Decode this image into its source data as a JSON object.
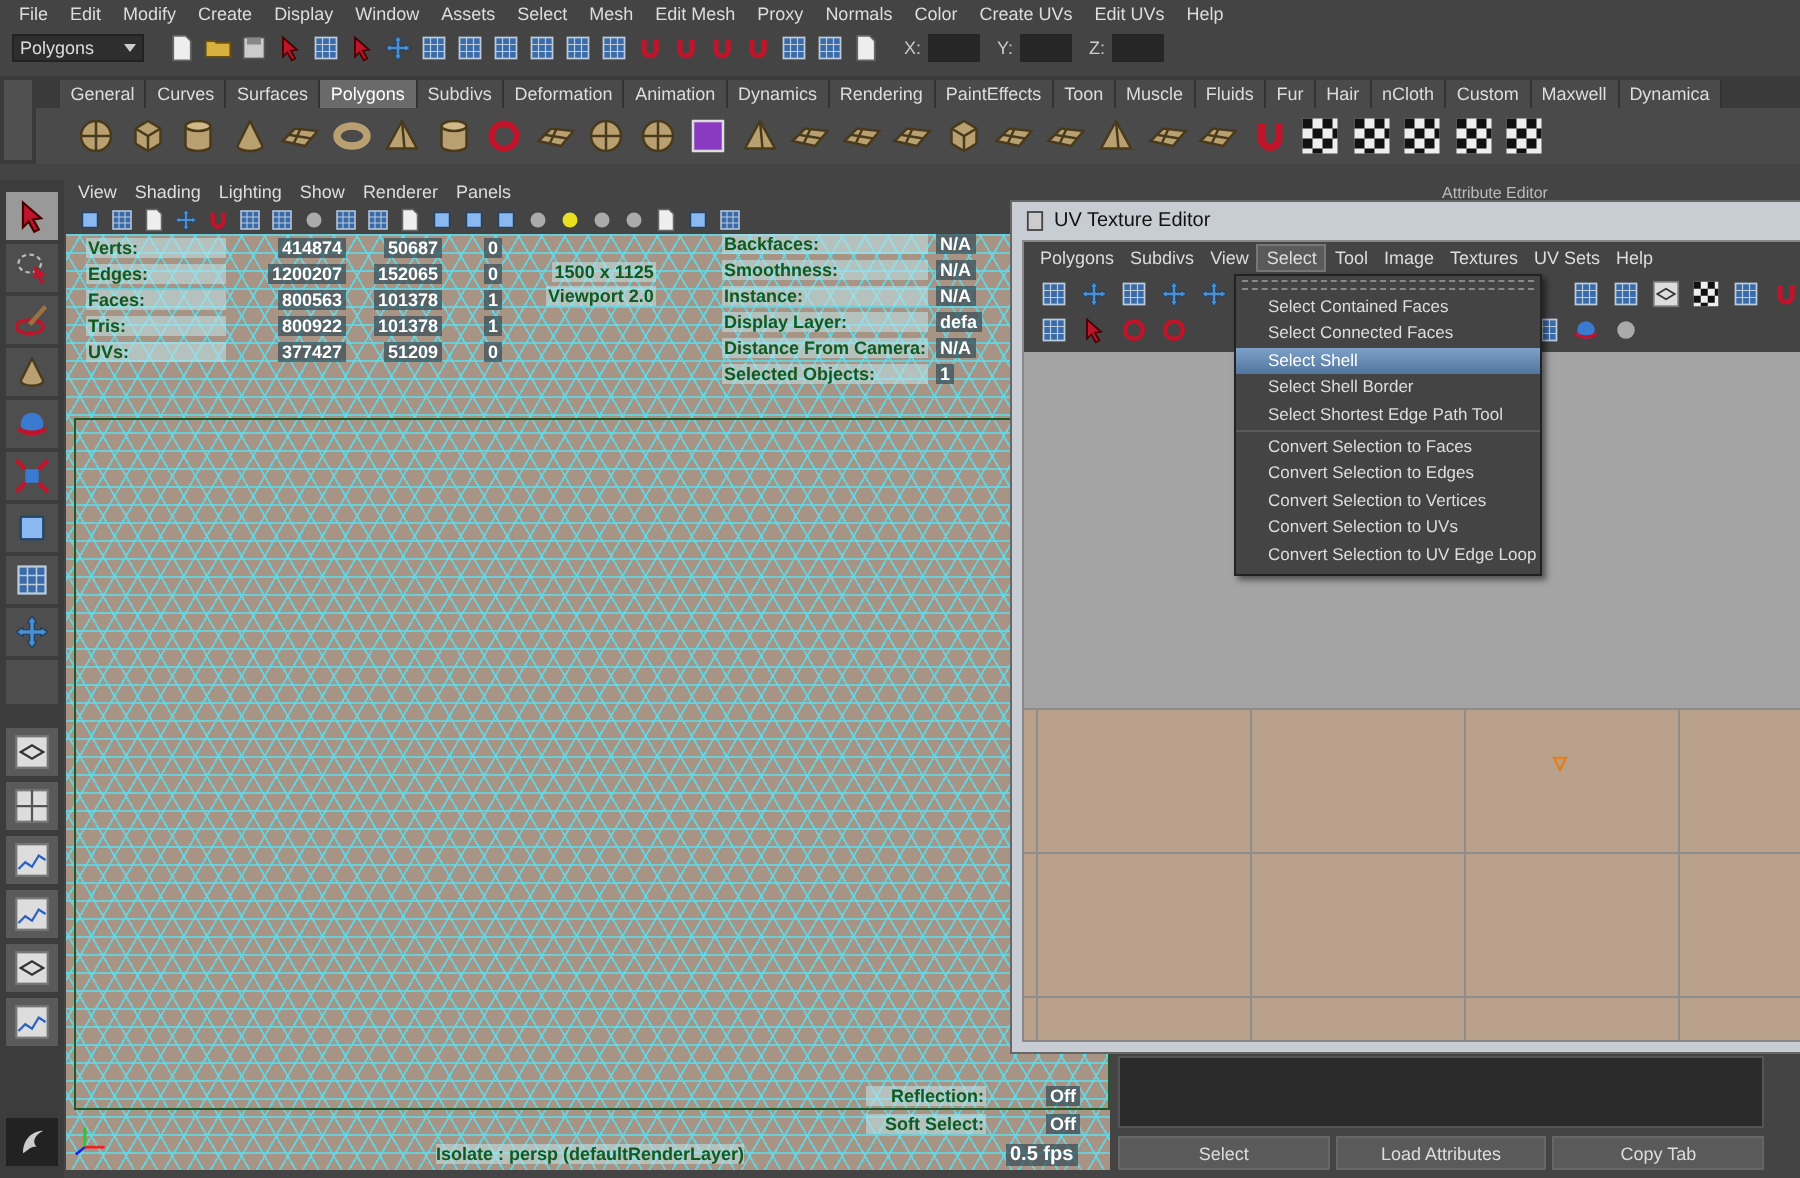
{
  "menu_bar": [
    "File",
    "Edit",
    "Modify",
    "Create",
    "Display",
    "Window",
    "Assets",
    "Select",
    "Mesh",
    "Edit Mesh",
    "Proxy",
    "Normals",
    "Color",
    "Create UVs",
    "Edit UVs",
    "Help"
  ],
  "status_line": {
    "mode_dropdown": "Polygons",
    "coordinate_labels": [
      "X:",
      "Y:",
      "Z:"
    ]
  },
  "shelf": {
    "tabs": [
      {
        "label": "General",
        "selected": false
      },
      {
        "label": "Curves",
        "selected": false
      },
      {
        "label": "Surfaces",
        "selected": false
      },
      {
        "label": "Polygons",
        "selected": true
      },
      {
        "label": "Subdivs",
        "selected": false
      },
      {
        "label": "Deformation",
        "selected": false
      },
      {
        "label": "Animation",
        "selected": false
      },
      {
        "label": "Dynamics",
        "selected": false
      },
      {
        "label": "Rendering",
        "selected": false
      },
      {
        "label": "PaintEffects",
        "selected": false
      },
      {
        "label": "Toon",
        "selected": false
      },
      {
        "label": "Muscle",
        "selected": false
      },
      {
        "label": "Fluids",
        "selected": false
      },
      {
        "label": "Fur",
        "selected": false
      },
      {
        "label": "Hair",
        "selected": false
      },
      {
        "label": "nCloth",
        "selected": false
      },
      {
        "label": "Custom",
        "selected": false
      },
      {
        "label": "Maxwell",
        "selected": false
      },
      {
        "label": "Dynamica",
        "selected": false
      }
    ]
  },
  "toolbox": {
    "tools": [
      {
        "selected": true
      },
      {
        "selected": false
      },
      {
        "selected": false
      },
      {
        "selected": false
      },
      {
        "selected": false
      },
      {
        "selected": false
      },
      {
        "selected": false
      },
      {
        "selected": false
      },
      {
        "selected": false
      }
    ]
  },
  "viewport": {
    "menu": [
      "View",
      "Shading",
      "Lighting",
      "Show",
      "Renderer",
      "Panels"
    ],
    "hud": {
      "stats": [
        {
          "label": "Verts:",
          "values": [
            "414874",
            "50687",
            "0"
          ]
        },
        {
          "label": "Edges:",
          "values": [
            "1200207",
            "152065",
            "0"
          ]
        },
        {
          "label": "Faces:",
          "values": [
            "800563",
            "101378",
            "1"
          ]
        },
        {
          "label": "Tris:",
          "values": [
            "800922",
            "101378",
            "1"
          ]
        },
        {
          "label": "UVs:",
          "values": [
            "377427",
            "51209",
            "0"
          ]
        }
      ],
      "resolution": "1500 x 1125",
      "renderer": "Viewport 2.0",
      "info": [
        {
          "label": "Backfaces:",
          "value": "N/A"
        },
        {
          "label": "Smoothness:",
          "value": "N/A"
        },
        {
          "label": "Instance:",
          "value": "N/A"
        },
        {
          "label": "Display Layer:",
          "value": "defa"
        },
        {
          "label": "Distance From Camera:",
          "value": "N/A"
        },
        {
          "label": "Selected Objects:",
          "value": "1"
        }
      ],
      "bottom_info": [
        {
          "label": "Reflection:",
          "value": "Off"
        },
        {
          "label": "Soft Select:",
          "value": "Off"
        }
      ],
      "isolate": "Isolate : persp (defaultRenderLayer)",
      "fps": "0.5 fps"
    }
  },
  "attribute_editor": {
    "title": "Attribute Editor",
    "buttons": [
      "Select",
      "Load Attributes",
      "Copy Tab"
    ]
  },
  "uv_texture_editor": {
    "title": "UV Texture Editor",
    "menu": [
      {
        "label": "Polygons",
        "selected": false
      },
      {
        "label": "Subdivs",
        "selected": false
      },
      {
        "label": "View",
        "selected": false
      },
      {
        "label": "Select",
        "selected": true
      },
      {
        "label": "Tool",
        "selected": false
      },
      {
        "label": "Image",
        "selected": false
      },
      {
        "label": "Textures",
        "selected": false
      },
      {
        "label": "UV Sets",
        "selected": false
      },
      {
        "label": "Help",
        "selected": false
      }
    ],
    "dropdown": {
      "groups": [
        {
          "items": [
            {
              "label": "Select Contained Faces",
              "selected": false
            },
            {
              "label": "Select Connected Faces",
              "selected": false
            },
            {
              "label": "Select Shell",
              "selected": true
            },
            {
              "label": "Select Shell Border",
              "selected": false
            },
            {
              "label": "Select Shortest Edge Path Tool",
              "selected": false
            }
          ]
        },
        {
          "items": [
            {
              "label": "Convert Selection to Faces",
              "selected": false
            },
            {
              "label": "Convert Selection to Edges",
              "selected": false
            },
            {
              "label": "Convert Selection to Vertices",
              "selected": false
            },
            {
              "label": "Convert Selection to UVs",
              "selected": false
            },
            {
              "label": "Convert Selection to UV Edge Loop",
              "selected": false
            }
          ]
        }
      ]
    }
  }
}
